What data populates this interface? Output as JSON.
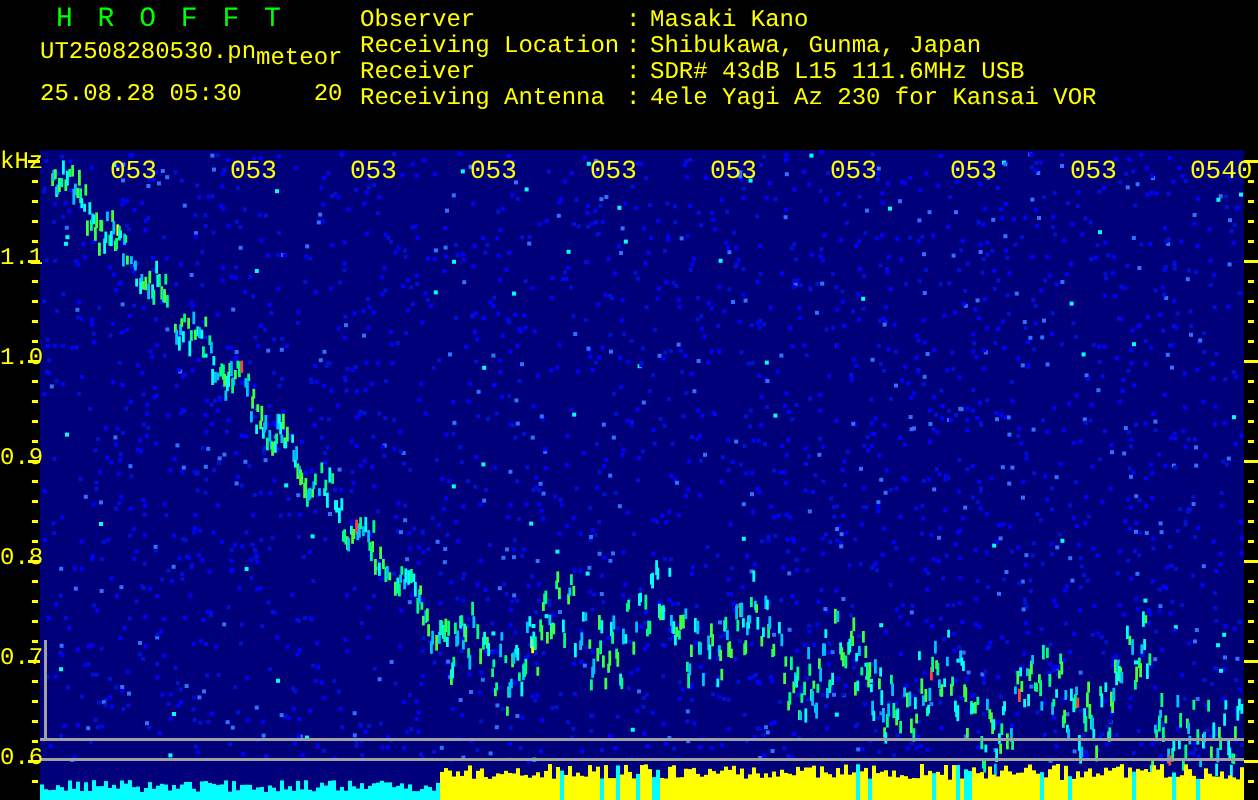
{
  "app_title": "H R O F F T",
  "file_name": "UT2508280530.pn",
  "mode": "meteor",
  "timestamp": "25.08.28 05:30",
  "count": "20",
  "separator": ":",
  "station_info": [
    {
      "label": "Observer",
      "value": "Masaki Kano"
    },
    {
      "label": "Receiving Location",
      "value": "Shibukawa, Gunma, Japan"
    },
    {
      "label": "Receiver",
      "value": "SDR# 43dB L15 111.6MHz USB"
    },
    {
      "label": "Receiving Antenna",
      "value": "4ele Yagi Az 230 for Kansai VOR"
    }
  ],
  "frequency_axis": {
    "unit": "kHz",
    "labels": [
      "1.1",
      "1.0",
      "0.9",
      "0.8",
      "0.7",
      "0.6"
    ]
  },
  "time_labels": [
    "053",
    "053",
    "053",
    "053",
    "053",
    "053",
    "053",
    "053",
    "053",
    "0540"
  ]
}
